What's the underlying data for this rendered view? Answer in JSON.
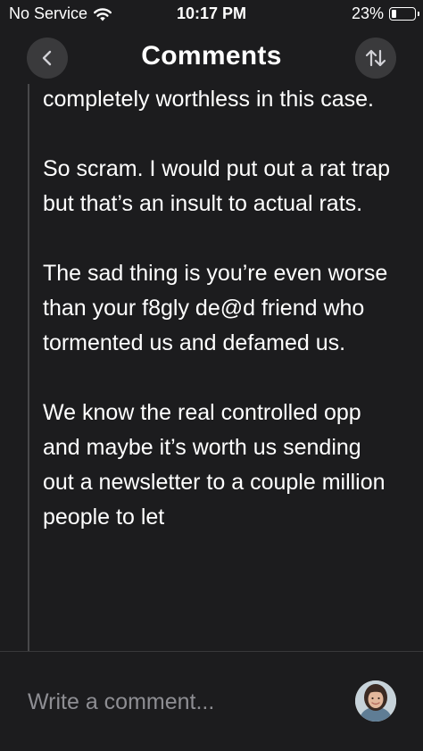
{
  "status_bar": {
    "carrier": "No Service",
    "time": "10:17 PM",
    "battery_percent": "23%",
    "battery_level": 0.23
  },
  "header": {
    "title": "Comments",
    "back_icon": "chevron-left-icon",
    "sort_icon": "sort-arrows-icon"
  },
  "comment": {
    "paragraphs": [
      "completely worthless in this case.",
      "So scram. I would put out a rat trap but that’s an insult to actual rats.",
      "The sad thing is you’re even worse than your f8gly de@d friend who tormented us and defamed us.",
      "We know the real controlled opp and maybe it’s worth us sending out a newsletter to a couple million people to let"
    ]
  },
  "composer": {
    "placeholder": "Write a comment..."
  },
  "colors": {
    "background": "#1c1c1e",
    "button_bg": "#3a3a3c",
    "thread_line": "#48484a",
    "placeholder": "#8e8e93"
  }
}
